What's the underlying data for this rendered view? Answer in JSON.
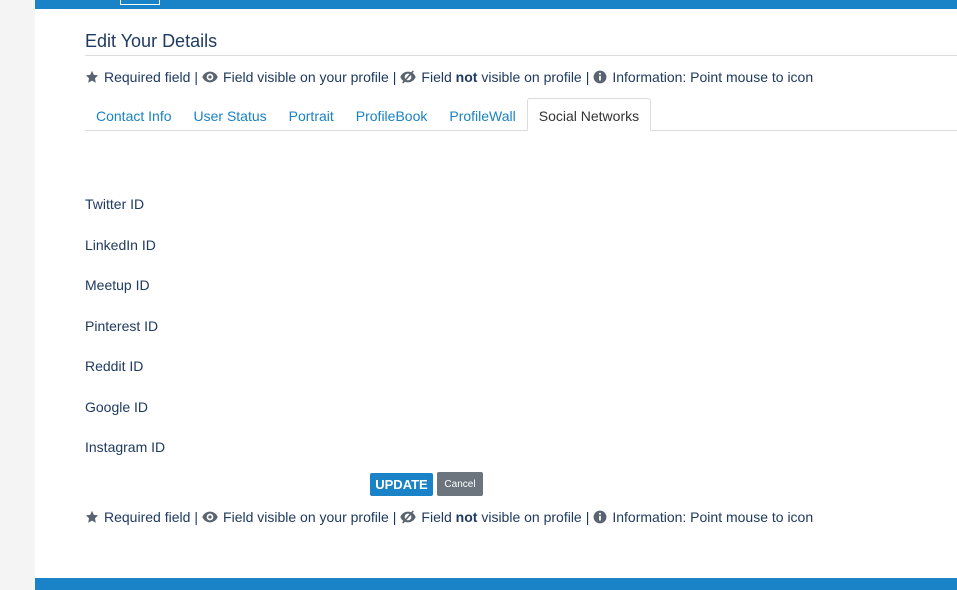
{
  "header": {
    "title": "Edit Your Details"
  },
  "legend": {
    "required": "Required field",
    "visible": "Field visible on your profile",
    "not_visible_prefix": "Field",
    "not_visible_bold": "not",
    "not_visible_suffix": "visible on profile",
    "info": "Information: Point mouse to icon",
    "separator": "|"
  },
  "tabs": [
    {
      "label": "Contact Info",
      "active": false
    },
    {
      "label": "User Status",
      "active": false
    },
    {
      "label": "Portrait",
      "active": false
    },
    {
      "label": "ProfileBook",
      "active": false
    },
    {
      "label": "ProfileWall",
      "active": false
    },
    {
      "label": "Social Networks",
      "active": true
    }
  ],
  "fields": [
    {
      "label": "Twitter ID"
    },
    {
      "label": "LinkedIn ID"
    },
    {
      "label": "Meetup ID"
    },
    {
      "label": "Pinterest ID"
    },
    {
      "label": "Reddit ID"
    },
    {
      "label": "Google ID"
    },
    {
      "label": "Instagram ID"
    }
  ],
  "buttons": {
    "update": "UPDATE",
    "cancel": "Cancel"
  },
  "colors": {
    "accent": "#1a82c7",
    "text": "#1f3a60",
    "cancel": "#6c757d",
    "icon": "#5a6470"
  },
  "icons": {
    "required": "star-icon",
    "visible": "eye-icon",
    "not_visible": "eye-slash-icon",
    "info": "info-circle-icon"
  }
}
